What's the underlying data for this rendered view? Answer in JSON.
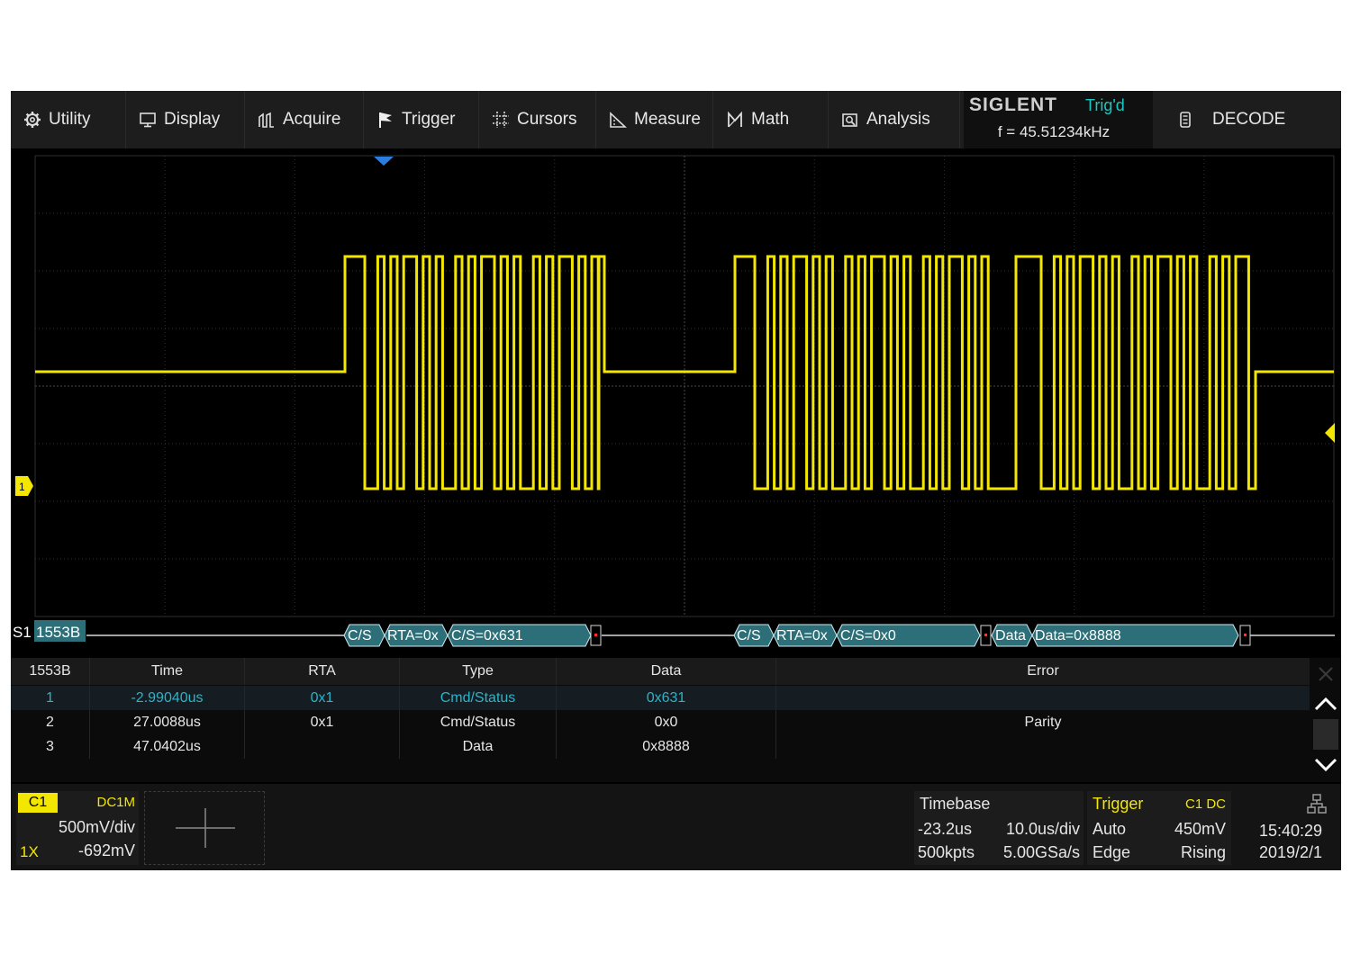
{
  "menu": {
    "items": [
      {
        "label": "Utility",
        "icon": "gear-icon"
      },
      {
        "label": "Display",
        "icon": "monitor-icon"
      },
      {
        "label": "Acquire",
        "icon": "acquire-icon"
      },
      {
        "label": "Trigger",
        "icon": "flag-icon"
      },
      {
        "label": "Cursors",
        "icon": "cursors-icon"
      },
      {
        "label": "Measure",
        "icon": "ruler-icon"
      },
      {
        "label": "Math",
        "icon": "math-icon"
      },
      {
        "label": "Analysis",
        "icon": "analysis-icon"
      }
    ],
    "brand": "SIGLENT",
    "trigger_state": "Trig'd",
    "frequency": "f = 45.51234kHz",
    "decode_label": "DECODE"
  },
  "waveform": {
    "channel_marker": "1",
    "trace_color": "#f3e600",
    "bus_color": "#2d6f78",
    "bus_label": "S1",
    "protocol_label": "1553B",
    "bus_annotations": [
      "C/S",
      "RTA=0x",
      "C/S=0x631",
      "C/S",
      "RTA=0x",
      "C/S=0x0",
      "Data",
      "Data=0x8888"
    ]
  },
  "decode_table": {
    "headers": [
      "1553B",
      "Time",
      "RTA",
      "Type",
      "Data",
      "Error"
    ],
    "rows": [
      [
        "1",
        "-2.99040us",
        "0x1",
        "Cmd/Status",
        "0x631",
        ""
      ],
      [
        "2",
        "27.0088us",
        "0x1",
        "Cmd/Status",
        "0x0",
        "Parity"
      ],
      [
        "3",
        "47.0402us",
        "",
        "Data",
        "0x8888",
        ""
      ]
    ],
    "selected_row": 0,
    "highlight_color": "#2ab4c8"
  },
  "channel1": {
    "label": "C1",
    "coupling": "DC1M",
    "volts_per_div": "500mV/div",
    "probe": "1X",
    "offset": "-692mV"
  },
  "timebase": {
    "title": "Timebase",
    "delay": "-23.2us",
    "time_per_div": "10.0us/div",
    "memory_depth": "500kpts",
    "sample_rate": "5.00GSa/s"
  },
  "trigger": {
    "title": "Trigger",
    "source": "C1 DC",
    "mode": "Auto",
    "level": "450mV",
    "type": "Edge",
    "slope": "Rising"
  },
  "clock": {
    "time": "15:40:29",
    "date": "2019/2/1"
  }
}
